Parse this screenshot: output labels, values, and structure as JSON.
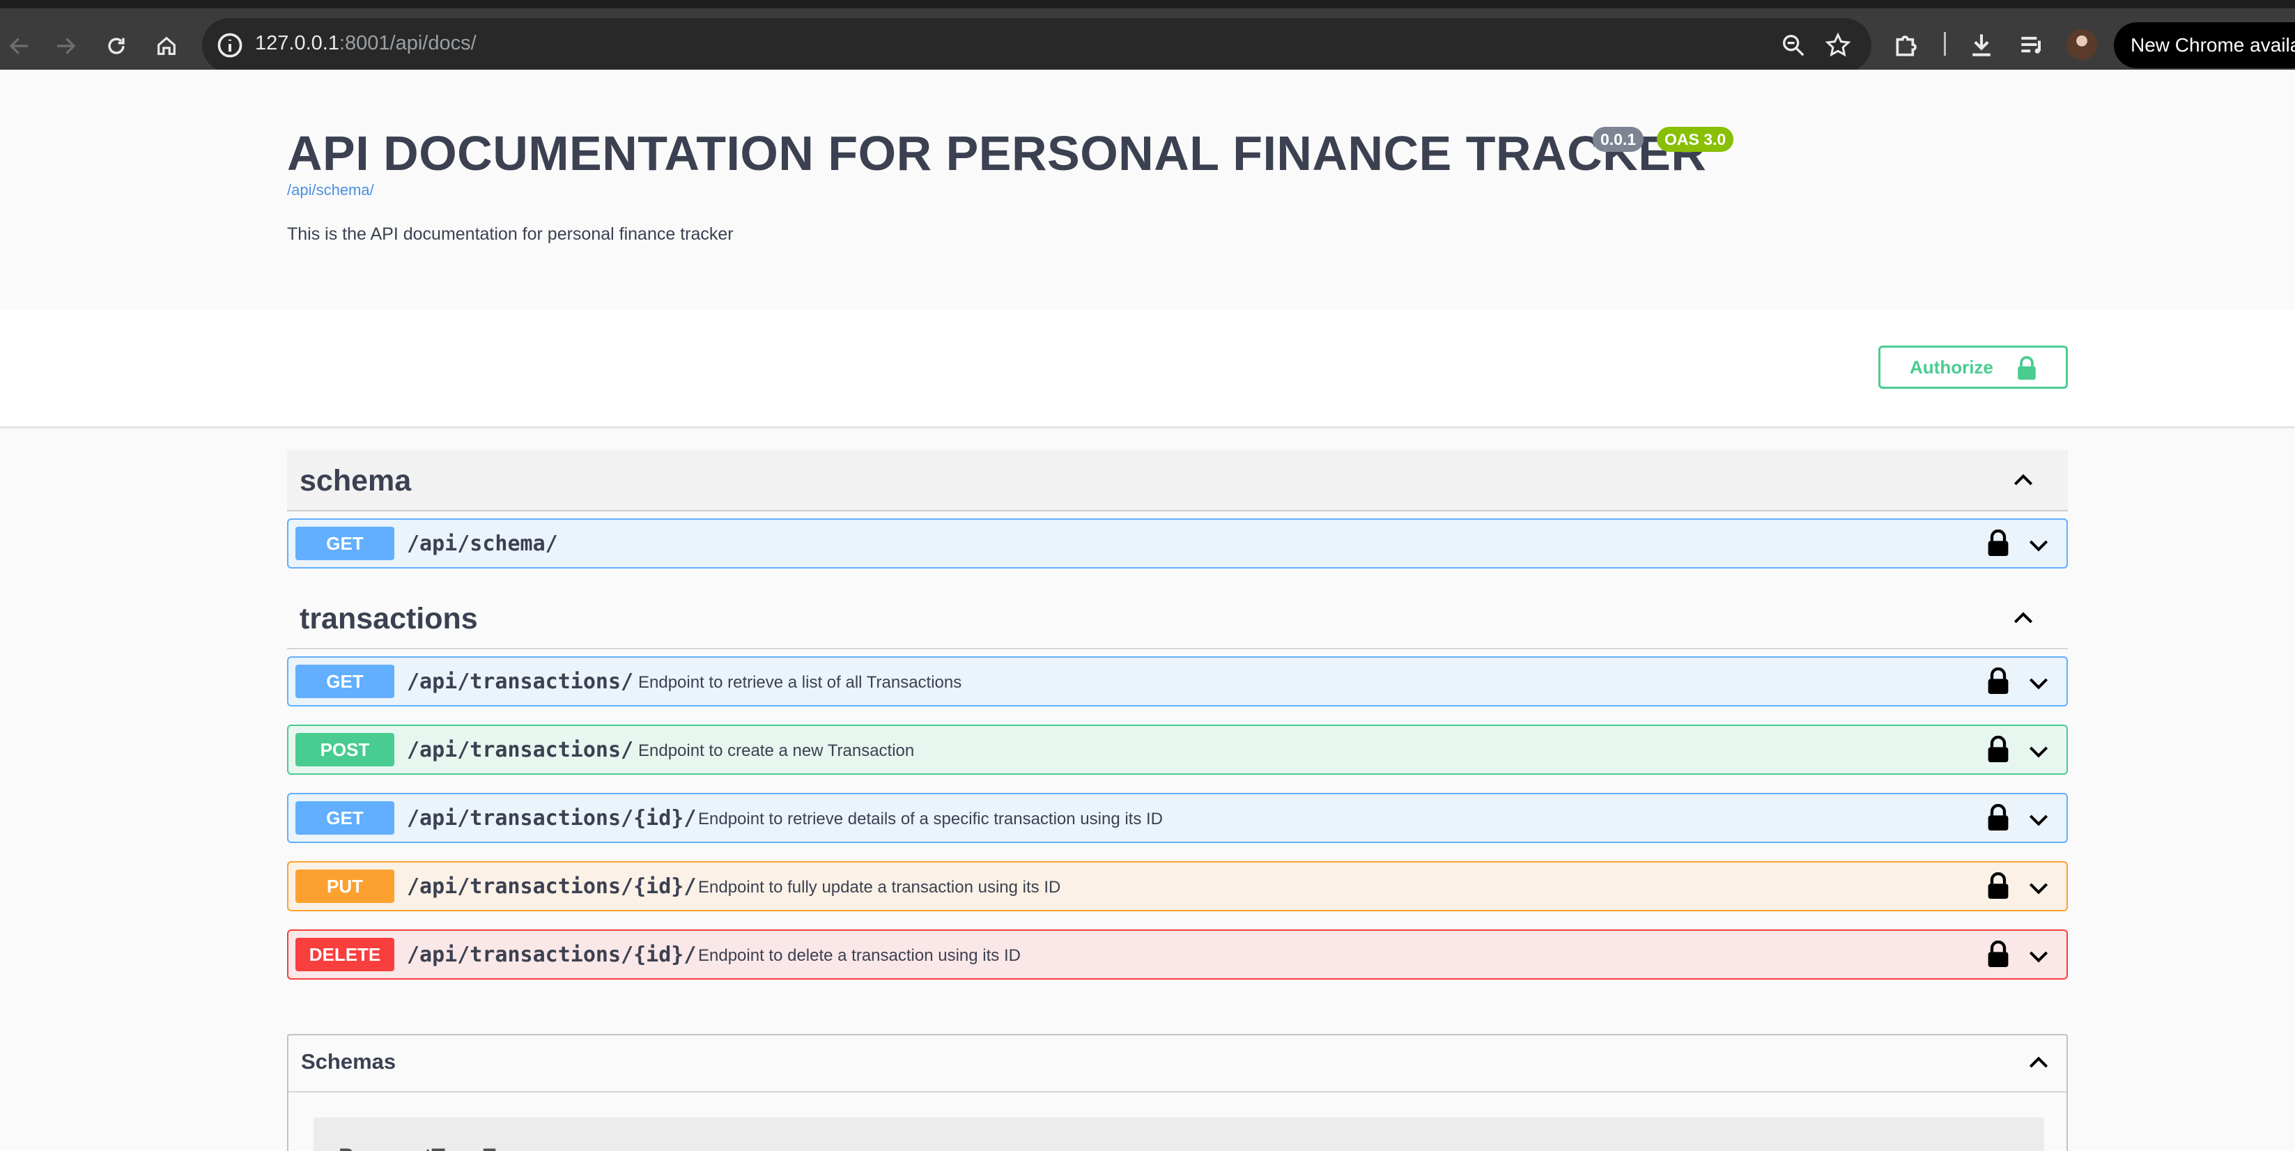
{
  "browser": {
    "url_host": "127.0.0.1",
    "url_rest": ":8001/api/docs/",
    "notice": "New Chrome availa"
  },
  "info": {
    "title": "API DOCUMENTATION FOR PERSONAL FINANCE TRACKER",
    "version": "0.0.1",
    "oas": "OAS 3.0",
    "schema_link": "/api/schema/",
    "description": "This is the API documentation for personal finance tracker"
  },
  "auth": {
    "label": "Authorize"
  },
  "tags": [
    {
      "name": "schema",
      "operations": [
        {
          "method": "GET",
          "path": "/api/schema/",
          "summary": ""
        }
      ]
    },
    {
      "name": "transactions",
      "operations": [
        {
          "method": "GET",
          "path": "/api/transactions/",
          "summary": "Endpoint to retrieve a list of all Transactions"
        },
        {
          "method": "POST",
          "path": "/api/transactions/",
          "summary": "Endpoint to create a new Transaction"
        },
        {
          "method": "GET",
          "path": "/api/transactions/{id}/",
          "summary": "Endpoint to retrieve details of a specific transaction using its ID"
        },
        {
          "method": "PUT",
          "path": "/api/transactions/{id}/",
          "summary": "Endpoint to fully update a transaction using its ID"
        },
        {
          "method": "DELETE",
          "path": "/api/transactions/{id}/",
          "summary": "Endpoint to delete a transaction using its ID"
        }
      ]
    }
  ],
  "models": {
    "title": "Schemas",
    "items": [
      {
        "name": "PaymentTypeEnum"
      }
    ]
  },
  "colors": {
    "get": "#61affe",
    "post": "#49cc90",
    "put": "#fca130",
    "delete": "#f93e3e",
    "authorize": "#49cc90"
  },
  "icons": {
    "back": "arrow-left-icon",
    "forward": "arrow-right-icon",
    "reload": "reload-icon",
    "home": "home-icon",
    "site_info": "info-icon",
    "zoom": "zoom-icon",
    "bookmark": "star-icon",
    "extensions": "puzzle-icon",
    "downloads": "download-icon",
    "reading_list": "playlist-icon",
    "lock": "lock-icon",
    "expand": "chevron-down-icon",
    "collapse": "chevron-up-icon"
  }
}
